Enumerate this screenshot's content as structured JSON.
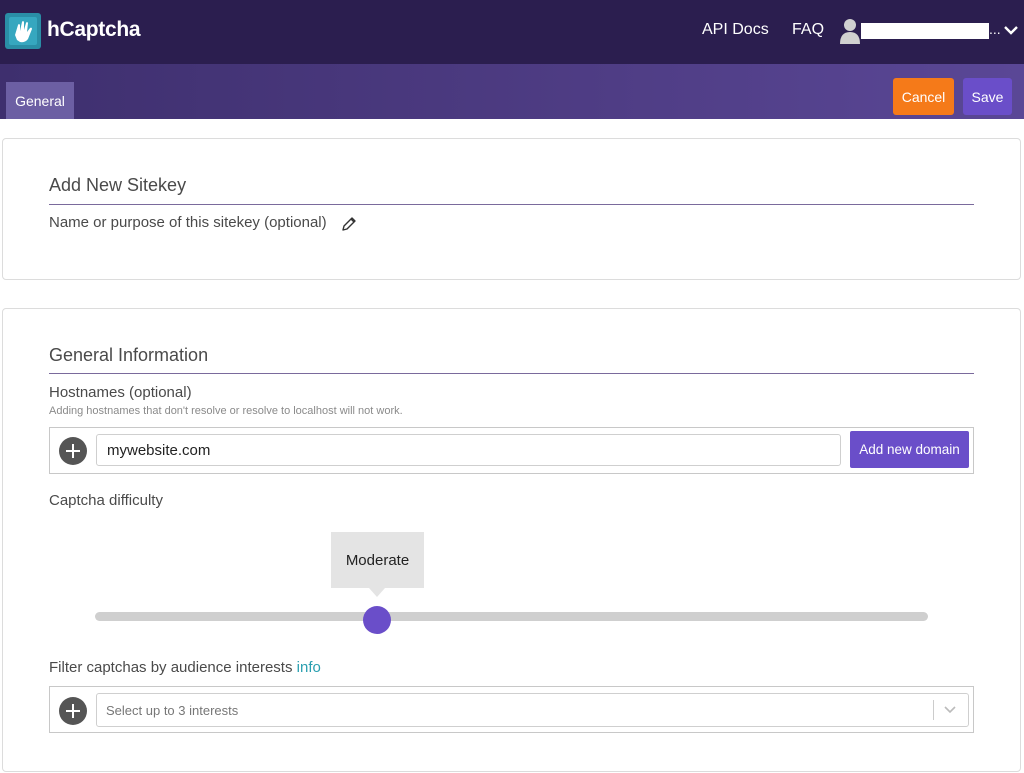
{
  "header": {
    "brand": "hCaptcha",
    "nav": {
      "api_docs": "API Docs",
      "faq": "FAQ"
    },
    "user": {
      "ellipsis": "..."
    }
  },
  "toolbar": {
    "tab_general": "General",
    "cancel_label": "Cancel",
    "save_label": "Save"
  },
  "sitekey_card": {
    "title": "Add New Sitekey",
    "name_placeholder": "Name or purpose of this sitekey (optional)"
  },
  "general_card": {
    "title": "General Information",
    "hostnames_label": "Hostnames (optional)",
    "hostnames_hint": "Adding hostnames that don't resolve or resolve to localhost will not work.",
    "hostname_value": "mywebsite.com",
    "add_domain_label": "Add new domain",
    "difficulty_label": "Captcha difficulty",
    "difficulty_value": "Moderate",
    "filter_label": "Filter captchas by audience interests",
    "filter_info": "info",
    "interests_placeholder": "Select up to 3 interests"
  },
  "colors": {
    "topbar": "#2b1e4f",
    "accent": "#6a4ec9",
    "cancel": "#f57a19",
    "info_link": "#2a9fb0"
  },
  "icons": {
    "logo": "hcaptcha-hand-icon",
    "user": "user-avatar-icon",
    "dropdown": "chevron-down-icon",
    "edit": "pencil-icon",
    "add": "plus-circle-icon"
  }
}
